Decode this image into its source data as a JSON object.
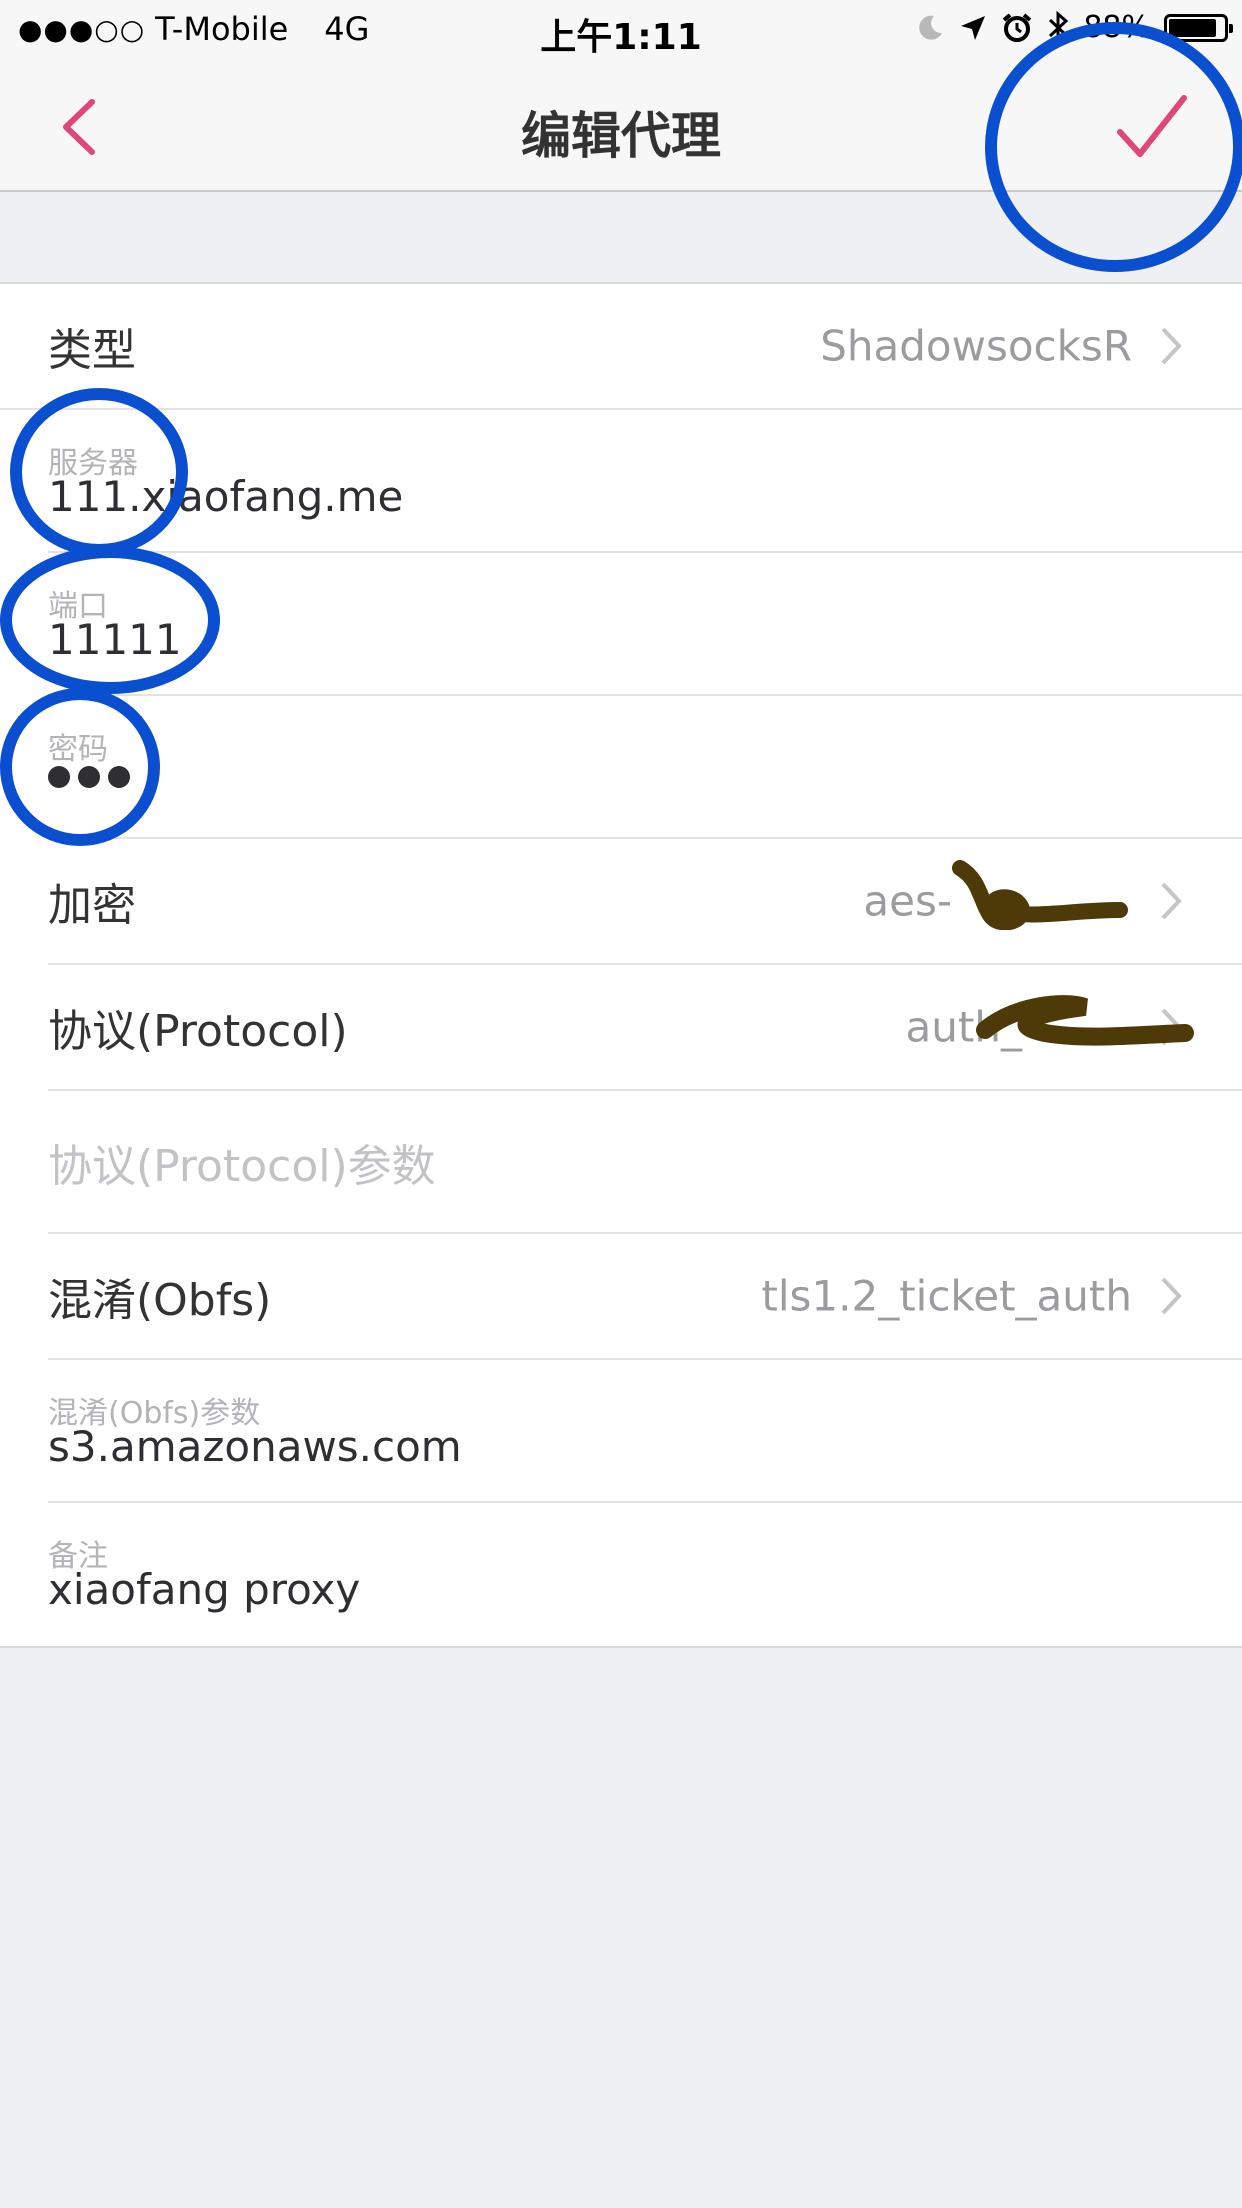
{
  "status_bar": {
    "signal_dots": "●●●○○",
    "carrier": "T-Mobile",
    "network": "4G",
    "time": "上午1:11",
    "battery_percent": "88%",
    "battery_level": 0.88,
    "icons": [
      "moon-icon",
      "location-icon",
      "alarm-icon",
      "bluetooth-icon",
      "battery-icon"
    ]
  },
  "nav": {
    "title": "编辑代理",
    "back_icon": "chevron-left-icon",
    "done_icon": "checkmark-icon",
    "accent_color": "#e0457b"
  },
  "form": {
    "type": {
      "label": "类型",
      "value": "ShadowsocksR"
    },
    "server": {
      "caption": "服务器",
      "value": "111.xiaofang.me"
    },
    "port": {
      "caption": "端口",
      "value": "11111"
    },
    "password": {
      "caption": "密码",
      "masked_length": 3
    },
    "encryption": {
      "label": "加密",
      "value": "aes-"
    },
    "protocol": {
      "label": "协议(Protocol)",
      "value": "auth_"
    },
    "protocol_param": {
      "placeholder": "协议(Protocol)参数"
    },
    "obfs": {
      "label": "混淆(Obfs)",
      "value": "tls1.2_ticket_auth"
    },
    "obfs_param": {
      "caption": "混淆(Obfs)参数",
      "value": "s3.amazonaws.com"
    },
    "remark": {
      "caption": "备注",
      "value": "xiaofang proxy"
    }
  },
  "annotation_color": "#0a4fcf",
  "redaction_color": "#4e3a08"
}
